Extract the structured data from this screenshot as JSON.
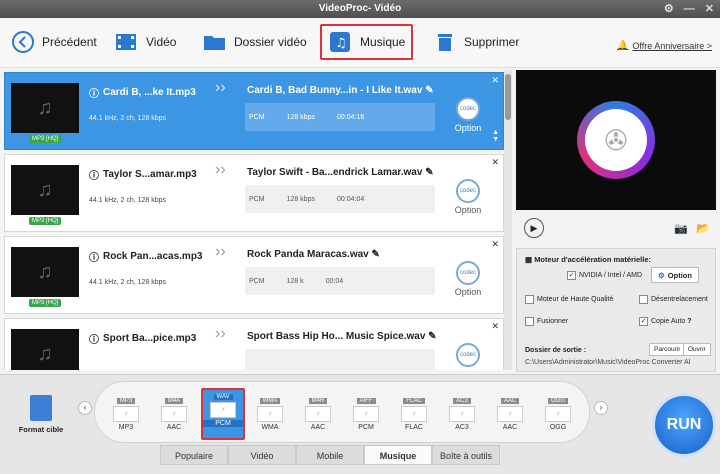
{
  "window": {
    "title": "VideoProc- Vidéo"
  },
  "toolbar": {
    "back": "Précédent",
    "video": "Vidéo",
    "folder": "Dossier vidéo",
    "music": "Musique",
    "delete": "Supprimer",
    "anniversary": "Offre Anniversaire >"
  },
  "files": [
    {
      "source": "Cardi B, ...ke It.mp3",
      "info": "44.1 kHz, 2 ch, 128 kbps",
      "badge": "MP3 [HQ]",
      "output": "Cardi B, Bad Bunny...in - I Like It.wav",
      "codec": "PCM",
      "bitrate": "128 kbps",
      "duration": "00:04:16",
      "option": "Option"
    },
    {
      "source": "Taylor S...amar.mp3",
      "info": "44.1 kHz, 2 ch, 128 kbps",
      "badge": "MP3 [HQ]",
      "output": "Taylor Swift - Ba...endrick Lamar.wav",
      "codec": "PCM",
      "bitrate": "128 kbps",
      "duration": "00:04:04",
      "option": "Option"
    },
    {
      "source": "Rock Pan...acas.mp3",
      "info": "44.1 kHz, 2 ch, 128 kbps",
      "badge": "MP3 [HQ]",
      "output": "Rock Panda  Maracas.wav",
      "codec": "PCM",
      "bitrate": "128 k",
      "duration": "00:04",
      "option": "Option"
    },
    {
      "source": "Sport Ba...pice.mp3",
      "info": "",
      "badge": "",
      "output": "Sport Bass Hip Ho... Music  Spice.wav",
      "codec": "",
      "bitrate": "",
      "duration": "",
      "option": "Option"
    }
  ],
  "settings": {
    "accel_title": "Moteur d'accélération matérielle:",
    "nvidia": "NVIDIA / Intel / AMD",
    "option_btn": "Option",
    "high_quality": "Moteur de Haute Qualité",
    "deinterlace": "Désentrelacement",
    "merge": "Fusionner",
    "auto_copy": "Copie Auto",
    "help": "?",
    "output_label": "Dossier de sortie :",
    "browse": "Parcourir",
    "open": "Ouvrir",
    "output_path": "C:\\Users\\Administrator\\Music\\VideoProc Converter AI"
  },
  "formats": [
    {
      "tag": "MP3",
      "label": "MP3"
    },
    {
      "tag": "M4A",
      "label": "AAC"
    },
    {
      "tag": "WAV",
      "label": "PCM"
    },
    {
      "tag": "WMA",
      "label": "WMA"
    },
    {
      "tag": "M4R",
      "label": "AAC"
    },
    {
      "tag": "AIFF",
      "label": "PCM"
    },
    {
      "tag": "FLAC",
      "label": "FLAC"
    },
    {
      "tag": "AC3",
      "label": "AC3"
    },
    {
      "tag": "AAC",
      "label": "AAC"
    },
    {
      "tag": "OGG",
      "label": "OGG"
    }
  ],
  "format_target": "Format cible",
  "tabs": [
    "Populaire",
    "Vidéo",
    "Mobile",
    "Musique",
    "Boîte à outils"
  ],
  "run": "RUN",
  "colors": {
    "accent": "#3c96e4",
    "highlight": "#e0303a",
    "badge": "#3aa64a"
  }
}
